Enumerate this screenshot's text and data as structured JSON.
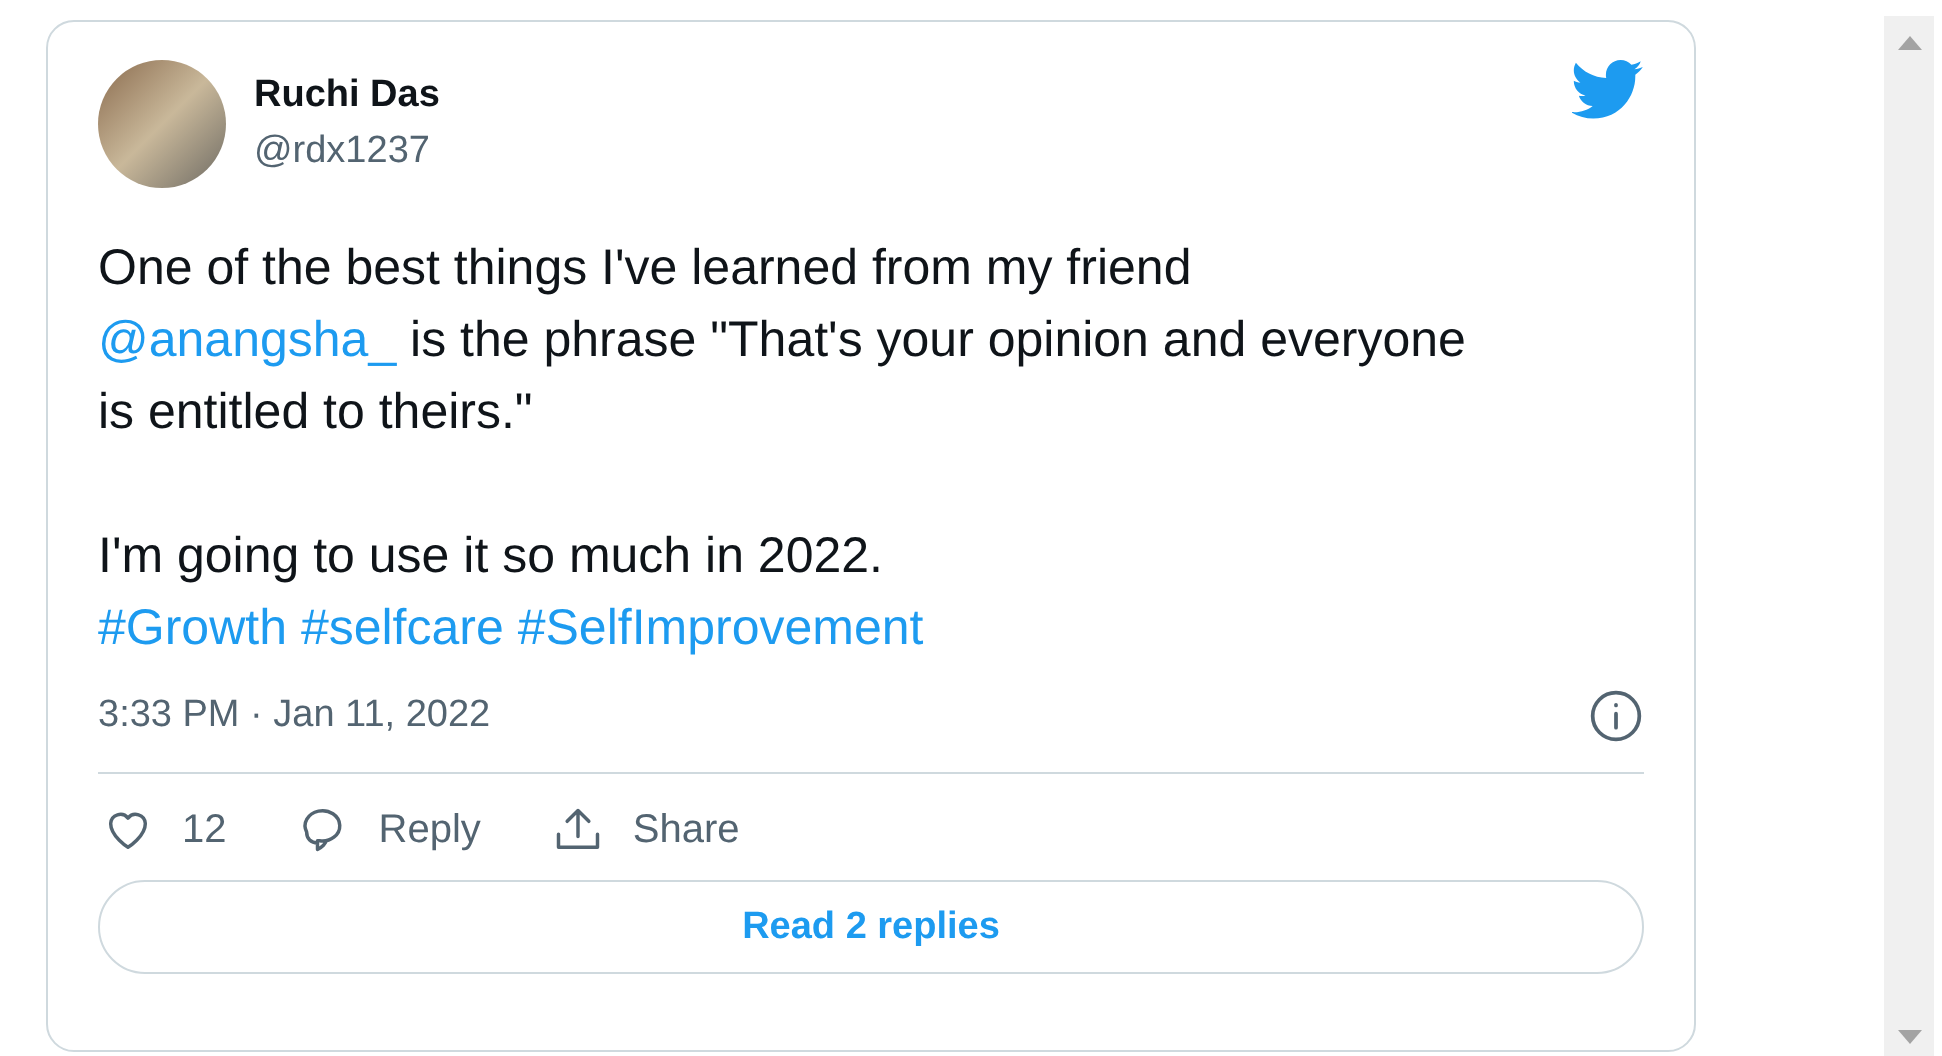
{
  "author": {
    "name": "Ruchi Das",
    "handle": "@rdx1237"
  },
  "body": [
    {
      "segments": [
        {
          "kind": "text",
          "text": "One of the best things I've learned from my friend "
        },
        {
          "kind": "link",
          "text": "@anangsha_"
        },
        {
          "kind": "text",
          "text": " is the phrase \"That's your opinion and everyone is entitled to theirs.\""
        }
      ]
    },
    {
      "segments": [
        {
          "kind": "text",
          "text": "I'm going to use it so much in 2022."
        }
      ]
    },
    {
      "segments": [
        {
          "kind": "link",
          "text": "#Growth"
        },
        {
          "kind": "link",
          "text": "#selfcare"
        },
        {
          "kind": "link",
          "text": "#SelfImprovement"
        }
      ]
    }
  ],
  "timestamp": "3:33 PM · Jan 11, 2022",
  "actions": [
    {
      "kind": "like",
      "label": "12"
    },
    {
      "kind": "reply",
      "label": "Reply"
    },
    {
      "kind": "share",
      "label": "Share"
    }
  ],
  "read_replies": "Read 2 replies"
}
